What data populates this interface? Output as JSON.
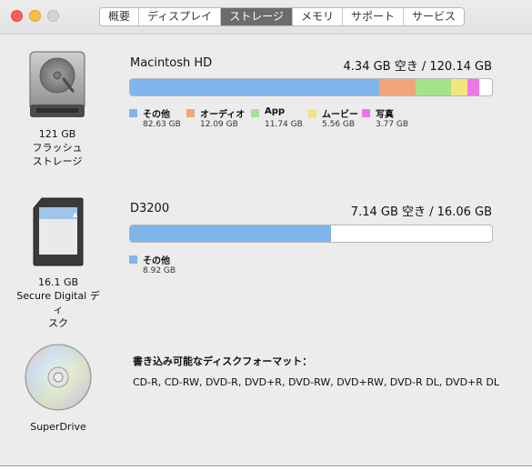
{
  "tabs": [
    {
      "label": "概要"
    },
    {
      "label": "ディスプレイ"
    },
    {
      "label": "ストレージ",
      "active": true
    },
    {
      "label": "メモリ"
    },
    {
      "label": "サポート"
    },
    {
      "label": "サービス"
    }
  ],
  "drives": [
    {
      "icon": "hard-drive-icon",
      "caption": [
        "121 GB",
        "フラッシュ",
        "ストレージ"
      ],
      "name": "Macintosh HD",
      "free": "4.34 GB 空き / 120.14 GB",
      "segments": [
        {
          "label": "その他",
          "size": "82.63 GB",
          "fraction": 0.688,
          "color": "#7eb5ea"
        },
        {
          "label": "オーディオ",
          "size": "12.09 GB",
          "fraction": 0.101,
          "color": "#f0a57c"
        },
        {
          "label": "App",
          "size": "11.74 GB",
          "fraction": 0.098,
          "color": "#a5e28a"
        },
        {
          "label": "ムービー",
          "size": "5.56 GB",
          "fraction": 0.046,
          "color": "#f4e47c"
        },
        {
          "label": "写真",
          "size": "3.77 GB",
          "fraction": 0.031,
          "color": "#ee76e6"
        }
      ]
    },
    {
      "icon": "sd-card-icon",
      "caption": [
        "16.1 GB",
        "Secure Digital ディ",
        "スク"
      ],
      "name": "D3200",
      "free": "7.14 GB 空き / 16.06 GB",
      "segments": [
        {
          "label": "その他",
          "size": "8.92 GB",
          "fraction": 0.555,
          "color": "#7eb5ea"
        }
      ]
    }
  ],
  "optical": {
    "icon": "optical-disc-icon",
    "caption": "SuperDrive",
    "formats_title": "書き込み可能なディスクフォーマット：",
    "formats": "CD-R, CD-RW, DVD-R, DVD+R, DVD-RW, DVD+RW, DVD-R DL, DVD+R DL"
  }
}
